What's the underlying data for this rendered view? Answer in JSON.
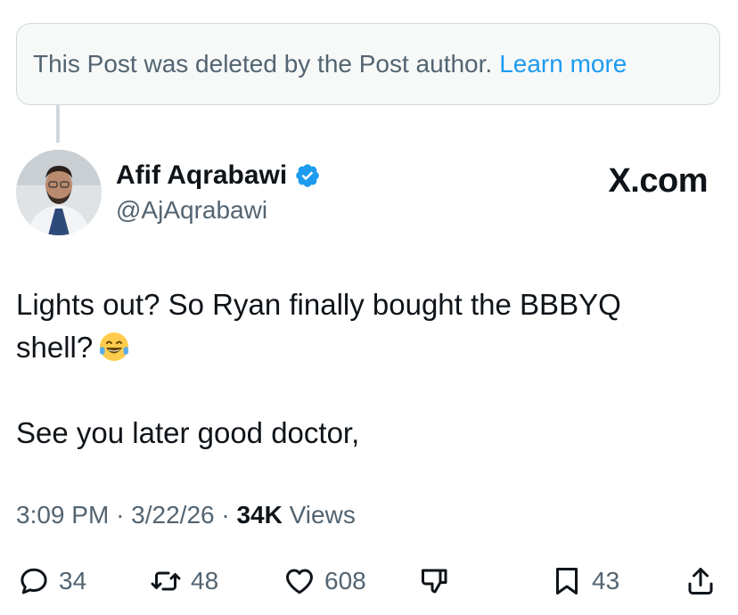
{
  "deleted_notice": {
    "text": "This Post was deleted by the Post author.",
    "link": "Learn more"
  },
  "author": {
    "name": "Afif Aqrabawi",
    "handle": "@AjAqrabawi",
    "verified": true
  },
  "brand": "X.com",
  "post": {
    "line1": "Lights out? So Ryan finally bought the BBBYQ",
    "line2": "shell?",
    "emoji": "face-with-tears-of-joy",
    "line3": "See you later good doctor,"
  },
  "meta": {
    "time": "3:09 PM",
    "sep1": "·",
    "date": "3/22/26",
    "sep2": "·",
    "views_count": "34K",
    "views_label": "Views"
  },
  "actions": {
    "replies": "34",
    "reposts": "48",
    "likes": "608",
    "bookmarks": "43"
  },
  "colors": {
    "accent": "#1d9bf0",
    "secondary_text": "#536471",
    "primary_text": "#0f1419"
  }
}
